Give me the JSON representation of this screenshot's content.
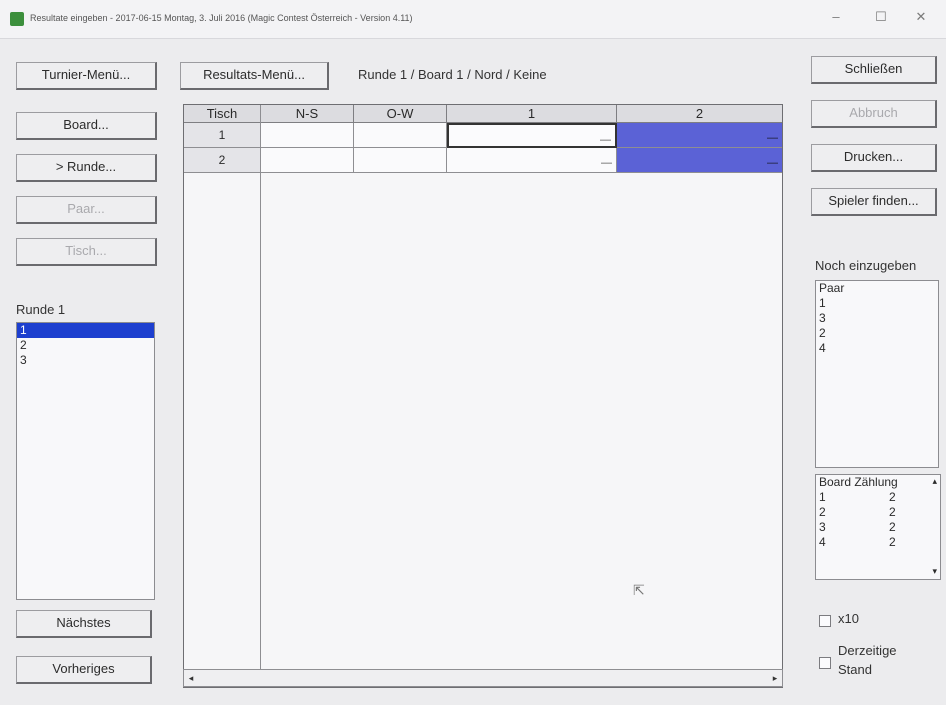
{
  "window": {
    "title": "Resultate eingeben - 2017-06-15 Montag, 3. Juli 2016 (Magic Contest Österreich - Version 4.11)",
    "controls": {
      "minimize": "–",
      "maximize": "☐",
      "close": "✕"
    }
  },
  "left_nav": {
    "turnier_menu": "Turnier-Menü...",
    "board": "Board...",
    "runde": "> Runde...",
    "paar": "Paar...",
    "tisch": "Tisch...",
    "runde_label": "Runde 1",
    "runde_items": [
      "1",
      "2",
      "3"
    ],
    "naechstes": "Nächstes",
    "vorheriges": "Vorheriges"
  },
  "top": {
    "resultats_menu": "Resultats-Menü...",
    "context": "Runde 1 / Board 1 / Nord / Keine"
  },
  "grid": {
    "headers": [
      "Tisch",
      "N-S",
      "O-W",
      "1",
      "2"
    ],
    "rows": [
      {
        "tisch": "1",
        "ns": "",
        "ow": "",
        "c1": "",
        "c2": ""
      },
      {
        "tisch": "2",
        "ns": "",
        "ow": "",
        "c1": "",
        "c2": ""
      }
    ],
    "dash": "—"
  },
  "right": {
    "schliessen": "Schließen",
    "abbruch": "Abbruch",
    "drucken": "Drucken...",
    "spieler_finden": "Spieler finden...",
    "noch_label": "Noch einzugeben",
    "noch_items": [
      "Paar",
      "1",
      "3",
      "2",
      "4"
    ],
    "board_header": "Board Zählung",
    "board_items": [
      {
        "board": "1",
        "count": "2"
      },
      {
        "board": "2",
        "count": "2"
      },
      {
        "board": "3",
        "count": "2"
      },
      {
        "board": "4",
        "count": "2"
      }
    ],
    "x10": "x10",
    "derzeitige": "Derzeitige",
    "stand": "Stand"
  },
  "scroll": {
    "left": "◂",
    "right": "▸",
    "up": "▴",
    "down": "▾"
  },
  "colors": {
    "selection": "#1d3fcf",
    "column2": "#5b62d6"
  }
}
